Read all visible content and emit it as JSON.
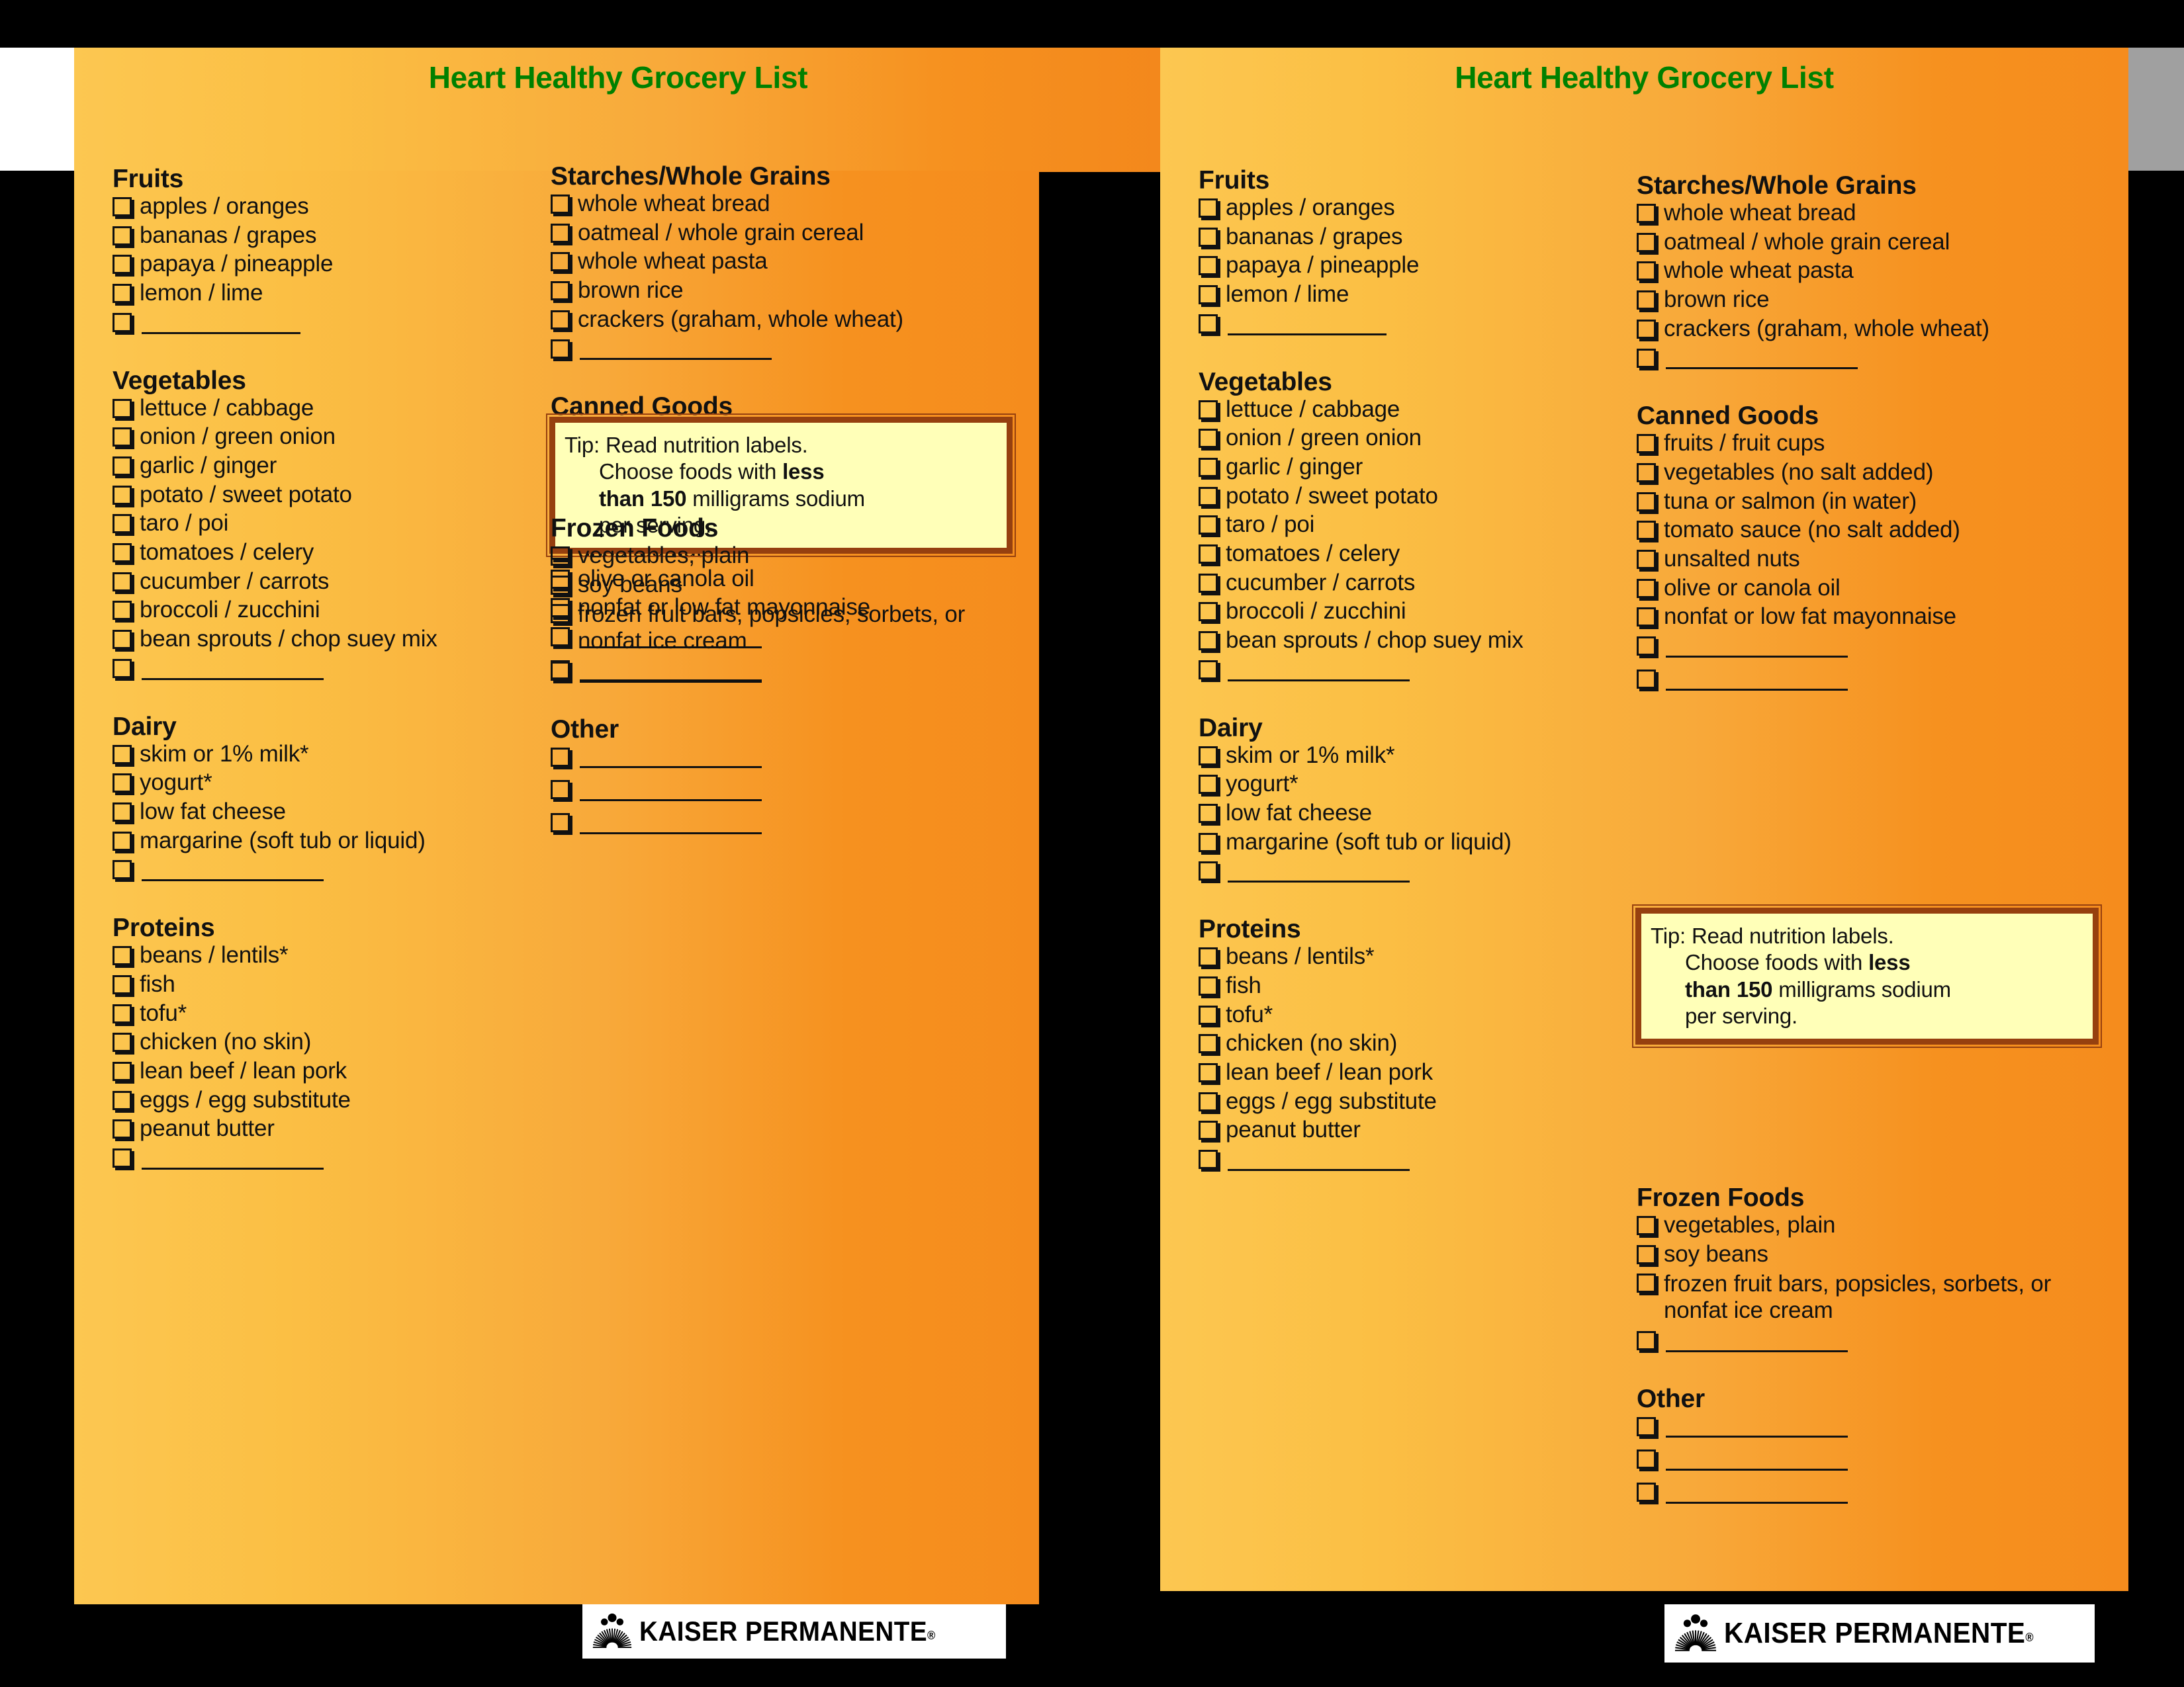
{
  "page": {
    "background_color": "#000000",
    "card_gradient_from": "#FCC751",
    "card_gradient_to": "#F58C1D",
    "title_color": "#008000",
    "tip_fill_color": "#FFFFB8",
    "tip_border_color": "#96400F"
  },
  "card": {
    "title": "Heart Healthy Grocery List",
    "left_column": [
      {
        "heading": "Fruits",
        "items": [
          {
            "text": "apples / oranges",
            "blank": false
          },
          {
            "text": "bananas / grapes",
            "blank": false
          },
          {
            "text": "papaya / pineapple",
            "blank": false
          },
          {
            "text": "lemon / lime",
            "blank": false
          },
          {
            "text": "",
            "blank": true,
            "rule_width": 240
          }
        ]
      },
      {
        "heading": "Vegetables",
        "items": [
          {
            "text": "lettuce / cabbage",
            "blank": false
          },
          {
            "text": "onion / green onion",
            "blank": false
          },
          {
            "text": "garlic / ginger",
            "blank": false
          },
          {
            "text": "potato /  sweet potato",
            "blank": false
          },
          {
            "text": "taro / poi",
            "blank": false
          },
          {
            "text": "tomatoes / celery",
            "blank": false
          },
          {
            "text": "cucumber / carrots",
            "blank": false
          },
          {
            "text": "broccoli / zucchini",
            "blank": false
          },
          {
            "text": "bean sprouts / chop suey mix",
            "blank": false
          },
          {
            "text": "",
            "blank": true,
            "rule_width": 275
          }
        ]
      },
      {
        "heading": "Dairy",
        "items": [
          {
            "text": "skim or 1% milk*",
            "blank": false
          },
          {
            "text": "yogurt*",
            "blank": false
          },
          {
            "text": "low fat cheese",
            "blank": false
          },
          {
            "text": "margarine (soft tub or liquid)",
            "blank": false
          },
          {
            "text": "",
            "blank": true,
            "rule_width": 275
          }
        ]
      },
      {
        "heading": "Proteins",
        "items": [
          {
            "text": "beans / lentils*",
            "blank": false
          },
          {
            "text": "fish",
            "blank": false
          },
          {
            "text": "tofu*",
            "blank": false
          },
          {
            "text": "chicken (no skin)",
            "blank": false
          },
          {
            "text": "lean beef / lean pork",
            "blank": false
          },
          {
            "text": "eggs / egg substitute",
            "blank": false
          },
          {
            "text": "peanut butter",
            "blank": false
          },
          {
            "text": "",
            "blank": true,
            "rule_width": 275
          }
        ]
      }
    ],
    "right_column_top": [
      {
        "heading": "Starches/Whole Grains",
        "items": [
          {
            "text": "whole wheat bread",
            "blank": false
          },
          {
            "text": "oatmeal / whole grain cereal",
            "blank": false
          },
          {
            "text": "whole wheat pasta",
            "blank": false
          },
          {
            "text": "brown rice",
            "blank": false
          },
          {
            "text": "crackers (graham, whole wheat)",
            "blank": false
          },
          {
            "text": "",
            "blank": true,
            "rule_width": 290
          }
        ]
      },
      {
        "heading": "Canned Goods",
        "items": [
          {
            "text": "fruits / fruit cups",
            "blank": false
          },
          {
            "text": "vegetables (no salt added)",
            "blank": false
          },
          {
            "text": "tuna or salmon (in water)",
            "blank": false
          },
          {
            "text": "tomato sauce (no salt added)",
            "blank": false
          },
          {
            "text": "unsalted nuts",
            "blank": false
          },
          {
            "text": "olive or canola oil",
            "blank": false
          },
          {
            "text": "nonfat or low fat mayonnaise",
            "blank": false
          },
          {
            "text": "",
            "blank": true,
            "rule_width": 275
          },
          {
            "text": "",
            "blank": true,
            "rule_width": 275
          }
        ]
      }
    ],
    "right_column_bottom": [
      {
        "heading": "Frozen Foods",
        "items": [
          {
            "text": "vegetables, plain",
            "blank": false
          },
          {
            "text": "soy beans",
            "blank": false
          },
          {
            "text": "frozen fruit bars, popsicles, sorbets, or nonfat ice cream",
            "blank": false,
            "two_line": true
          },
          {
            "text": "",
            "blank": true,
            "rule_width": 275
          }
        ]
      },
      {
        "heading": "Other",
        "items": [
          {
            "text": "",
            "blank": true,
            "rule_width": 275
          },
          {
            "text": "",
            "blank": true,
            "rule_width": 275
          },
          {
            "text": "",
            "blank": true,
            "rule_width": 275
          }
        ]
      }
    ],
    "tip": {
      "label": "Tip:",
      "line1": "Read nutrition labels.",
      "line2_pre": "Choose foods with ",
      "line2_bold": "less",
      "line3_bold": "than 150",
      "line3_post": " milligrams sodium",
      "line4": "per serving."
    },
    "logo": {
      "name": "KAISER PERMANENTE",
      "registered_mark": "®"
    }
  }
}
